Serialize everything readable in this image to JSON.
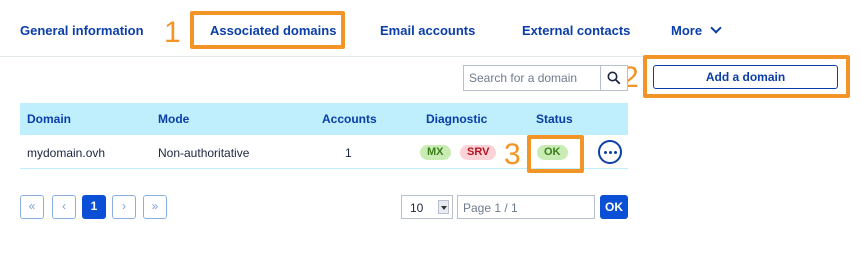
{
  "tabs": {
    "general": "General information",
    "domains": "Associated domains",
    "email": "Email accounts",
    "external": "External contacts",
    "more": "More"
  },
  "callouts": [
    "1",
    "2",
    "3"
  ],
  "search": {
    "placeholder": "Search for a domain"
  },
  "add_domain_label": "Add a domain",
  "table": {
    "columns": [
      "Domain",
      "Mode",
      "Accounts",
      "Diagnostic",
      "Status"
    ],
    "rows": [
      {
        "domain": "mydomain.ovh",
        "mode": "Non-authoritative",
        "accounts": "1",
        "diagnostic": [
          "MX",
          "SRV"
        ],
        "status": "OK"
      }
    ]
  },
  "pagination": {
    "first": "«",
    "prev": "‹",
    "current": "1",
    "next": "›",
    "last": "»",
    "per_page": "10",
    "page_placeholder": "Page 1 / 1",
    "ok_label": "OK"
  },
  "colors": {
    "accent": "#0a3ea8",
    "highlight": "#f39426",
    "header_bg": "#bfeefc",
    "ok_badge": "#c8ecb3",
    "error_badge": "#fbd3d6"
  }
}
